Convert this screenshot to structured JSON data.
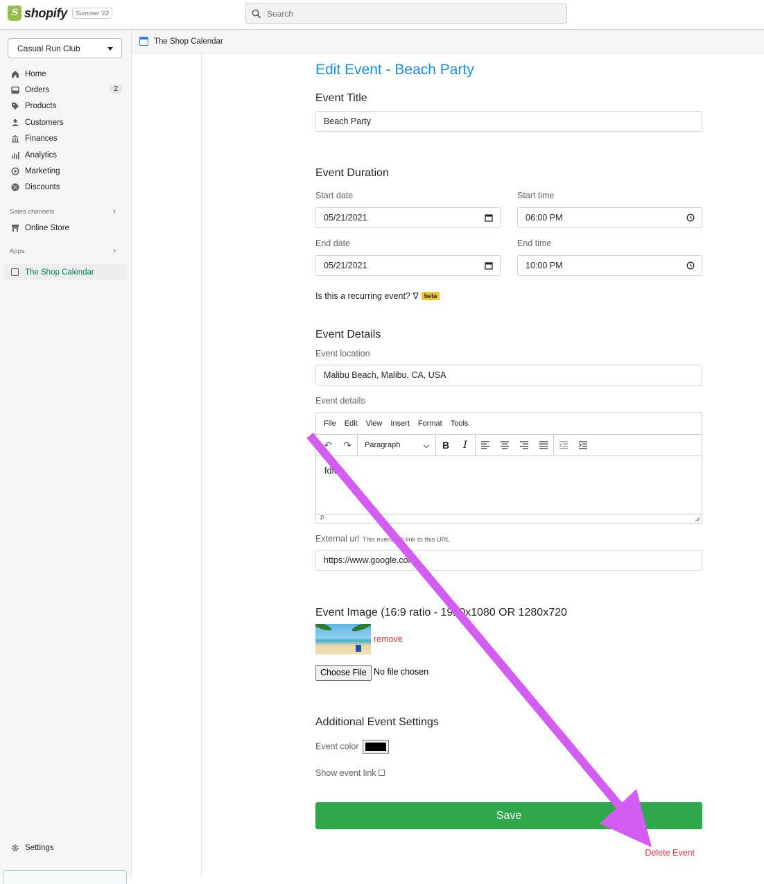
{
  "topbar": {
    "brand": "shopify",
    "edition_badge": "Summer '22",
    "search_placeholder": "Search"
  },
  "sidebar": {
    "store_name": "Casual Run Club",
    "items": [
      {
        "label": "Home",
        "icon": "home-icon"
      },
      {
        "label": "Orders",
        "icon": "orders-icon",
        "count": "2"
      },
      {
        "label": "Products",
        "icon": "tag-icon"
      },
      {
        "label": "Customers",
        "icon": "person-icon"
      },
      {
        "label": "Finances",
        "icon": "bank-icon"
      },
      {
        "label": "Analytics",
        "icon": "bar-chart-icon"
      },
      {
        "label": "Marketing",
        "icon": "target-icon"
      },
      {
        "label": "Discounts",
        "icon": "discount-icon"
      }
    ],
    "sales_channels_label": "Sales channels",
    "online_store_label": "Online Store",
    "apps_label": "Apps",
    "active_app_label": "The Shop Calendar",
    "settings_label": "Settings"
  },
  "appbar": {
    "title": "The Shop Calendar"
  },
  "form": {
    "page_title": "Edit Event - Beach Party",
    "event_title_heading": "Event Title",
    "event_title_value": "Beach Party",
    "duration_heading": "Event Duration",
    "start_date_label": "Start date",
    "start_date_value": "05/21/2021",
    "start_time_label": "Start time",
    "start_time_value": "06:00 PM",
    "end_date_label": "End date",
    "end_date_value": "05/21/2021",
    "end_time_label": "End time",
    "end_time_value": "10:00 PM",
    "recurring_label": "Is this a recurring event? ∇",
    "beta_badge": "beta",
    "details_heading": "Event Details",
    "location_label": "Event location",
    "location_value": "Malibu Beach, Malibu, CA, USA",
    "details_label": "Event details",
    "editor": {
      "menus": [
        "File",
        "Edit",
        "View",
        "Insert",
        "Format",
        "Tools"
      ],
      "block_format": "Paragraph",
      "content": "fdfdf",
      "status_path": "P"
    },
    "external_url_label": "External url",
    "external_url_hint": "This event will link to this URL",
    "external_url_value": "https://www.google.com",
    "image_heading": "Event Image (16:9 ratio - 1920x1080 OR 1280x720",
    "remove_label": "remove",
    "choose_file_label": "Choose File",
    "no_file_label": "No file chosen",
    "additional_heading": "Additional Event Settings",
    "event_color_label": "Event color",
    "event_color_value": "#000000",
    "show_link_label": "Show event link",
    "save_label": "Save",
    "delete_label": "Delete Event"
  },
  "colors": {
    "accent_blue": "#1a8cea",
    "save_green": "#2ea84b",
    "danger_red": "#dc3545",
    "annotation_arrow": "#d35cf2"
  }
}
